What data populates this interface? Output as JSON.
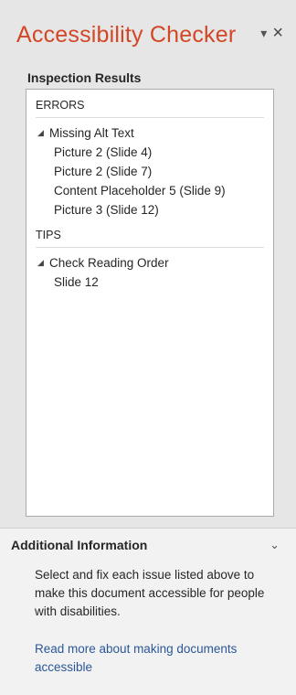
{
  "pane": {
    "title": "Accessibility Checker",
    "menu_glyph": "▾",
    "close_glyph": "×",
    "section_heading": "Inspection Results"
  },
  "groups": [
    {
      "label": "ERRORS",
      "issues": [
        {
          "title": "Missing Alt Text",
          "items": [
            "Picture 2  (Slide 4)",
            "Picture 2  (Slide 7)",
            "Content Placeholder 5  (Slide 9)",
            "Picture 3  (Slide 12)"
          ]
        }
      ]
    },
    {
      "label": "TIPS",
      "issues": [
        {
          "title": "Check Reading Order",
          "items": [
            "Slide 12"
          ]
        }
      ]
    }
  ],
  "additional": {
    "heading": "Additional Information",
    "chevron": "⌄",
    "body": "Select and fix each issue listed above to make this document accessible for people with disabilities.",
    "link": "Read more about making documents accessible"
  },
  "colors": {
    "title": "#d24726",
    "link": "#2b5797",
    "pane_bg": "#e6e6e6"
  }
}
